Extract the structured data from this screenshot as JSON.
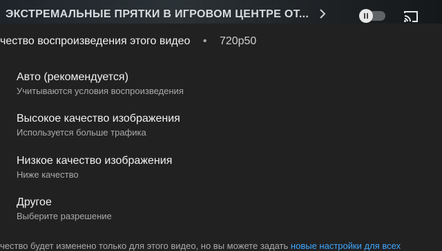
{
  "player": {
    "video_title": "ЭКСТРЕМАЛЬНЫЕ ПРЯТКИ В ИГРОВОМ ЦЕНТРЕ ОТ...",
    "next_icon": "chevron-right-icon",
    "autoplay_icon": "pause-icon",
    "cast_icon": "cast-icon"
  },
  "quality_sheet": {
    "title_visible": "чество воспроизведения этого видео",
    "separator": "•",
    "current_quality": "720p50",
    "options": [
      {
        "label": "Авто (рекомендуется)",
        "description": "Учитываются условия воспроизведения"
      },
      {
        "label": "Высокое качество изображения",
        "description": "Используется больше трафика"
      },
      {
        "label": "Низкое качество изображения",
        "description": "Ниже качество"
      },
      {
        "label": "Другое",
        "description": "Выберите разрешение"
      }
    ],
    "footer_text": "чество будет изменено только для этого видео, но вы можете задать ",
    "footer_link": "новые настройки для всех"
  },
  "colors": {
    "background": "#212121",
    "text_primary": "#f1f1f1",
    "text_secondary": "#aaaaaa",
    "link": "#3ea6ff"
  }
}
